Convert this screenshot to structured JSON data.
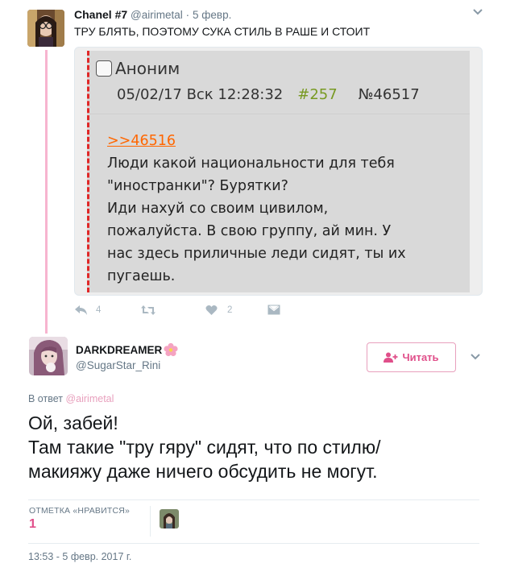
{
  "parent_tweet": {
    "author_name": "Chanel #7",
    "author_handle": "@airimetal",
    "separator": "·",
    "date": "5 февр.",
    "text": "ТРУ БЛЯТЬ, ПОЭТОМУ СУКА СТИЛЬ В РАШЕ И СТОИТ",
    "embedded_post": {
      "name": "Аноним",
      "datetime": "05/02/17 Вск 12:28:32",
      "post_num": "#257",
      "post_id": "№46517",
      "reply_link": ">>46516",
      "body_lines": [
        "Люди какой национальности для тебя",
        "\"иностранки\"? Бурятки?",
        "Иди нахуй со своим цивилом,",
        "пожалуйста. В свою группу, ай мин. У",
        "нас здесь приличные леди сидят, ты их",
        "пугаешь."
      ]
    },
    "actions": {
      "reply_count": "4",
      "retweet_count": "",
      "like_count": "2"
    }
  },
  "main_tweet": {
    "author_name": "DARKDREAMER",
    "author_handle": "@SugarStar_Rini",
    "follow_label": "Читать",
    "reply_prefix": "В ответ",
    "reply_mention": "@airimetal",
    "text_lines": [
      "Ой, забей!",
      "Там такие \"тру гяру\" сидят, что по стилю/",
      "макияжу даже ничего обсудить не могут."
    ],
    "likes_label": "ОТМЕТКА «НРАВИТСЯ»",
    "likes_count": "1",
    "timestamp": "13:53 - 5 февр. 2017 г."
  },
  "colors": {
    "accent_pink": "#e04f8a",
    "thread_line": "#f7b4cf",
    "greentext": "#789922",
    "link_orange": "#ff6600",
    "post_border_red": "#e02828"
  },
  "icons": [
    "chevron-down-icon",
    "reply-icon",
    "retweet-icon",
    "heart-icon",
    "direct-message-icon",
    "add-user-icon",
    "sakura-flower-icon"
  ]
}
